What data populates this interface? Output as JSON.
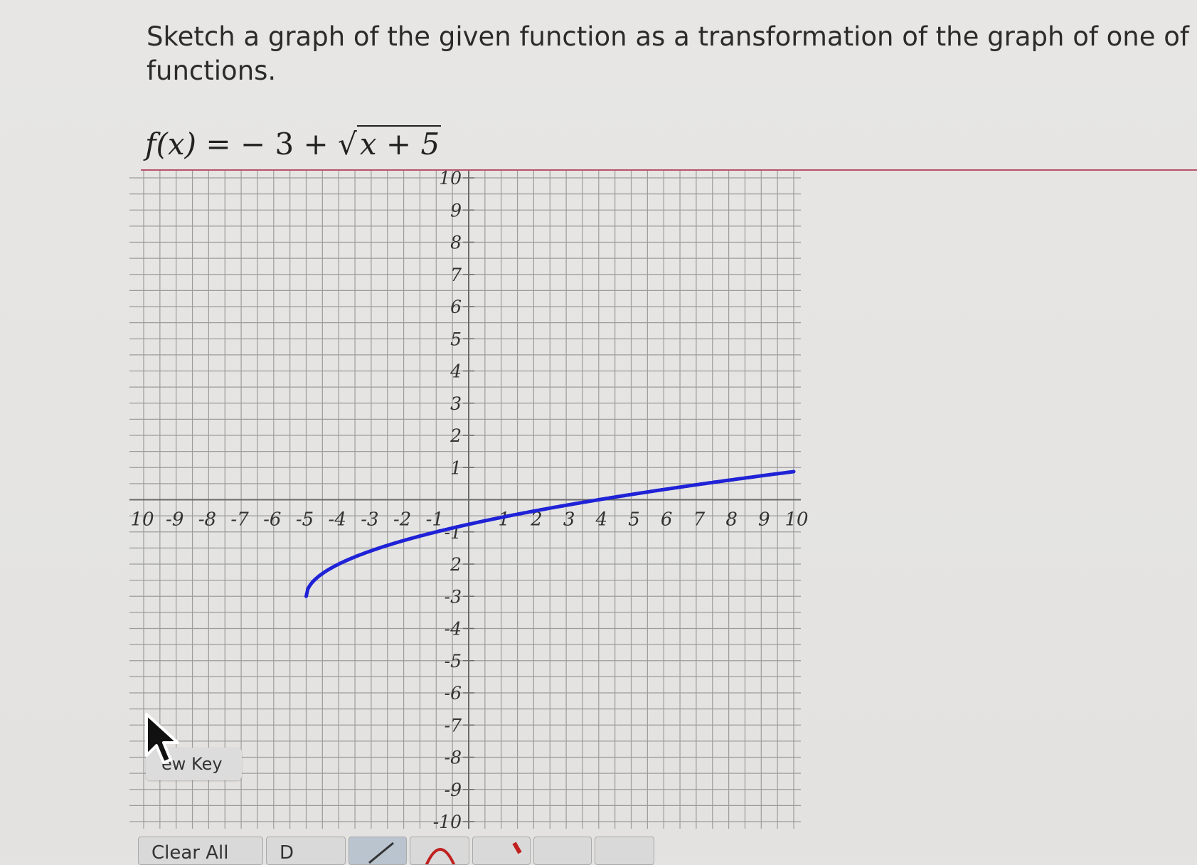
{
  "question": {
    "prompt_line1": "Sketch a graph of the given function as a transformation of the graph of one of the toolk",
    "prompt_line2": "functions.",
    "formula_fx": "f(x)",
    "formula_equals": "=",
    "formula_rest": "− 3 +",
    "formula_radicand": "x + 5"
  },
  "view_key_label": "ew Key",
  "toolbar": {
    "clear_all_label": "Clear All",
    "draw_label": "D"
  },
  "colors": {
    "curve": "#1f22d6",
    "grid": "#9c9c9c",
    "question_rule": "#b8536a"
  },
  "icons": [
    "cursor-arrow-icon",
    "line-tool-icon",
    "parabola-tool-icon",
    "pencil-tool-icon"
  ],
  "chart_data": {
    "type": "line",
    "title": "",
    "xlabel": "",
    "ylabel": "",
    "xlim": [
      -10,
      10
    ],
    "ylim": [
      -10,
      10
    ],
    "grid": true,
    "x_ticks": [
      "10",
      "-9",
      "-8",
      "-7",
      "-6",
      "-5",
      "-4",
      "-3",
      "-2",
      "-1",
      "1",
      "2",
      "3",
      "4",
      "5",
      "6",
      "7",
      "8",
      "9",
      "10"
    ],
    "x_tick_values": [
      -10,
      -9,
      -8,
      -7,
      -6,
      -5,
      -4,
      -3,
      -2,
      -1,
      1,
      2,
      3,
      4,
      5,
      6,
      7,
      8,
      9,
      10
    ],
    "y_ticks": [
      "10",
      "9",
      "8",
      "7",
      "6",
      "5",
      "4",
      "3",
      "2",
      "1",
      "-1",
      "2",
      "-3",
      "-4",
      "-5",
      "-6",
      "-7",
      "-8",
      "-9",
      "-10"
    ],
    "y_tick_values": [
      10,
      9,
      8,
      7,
      6,
      5,
      4,
      3,
      2,
      1,
      -1,
      -2,
      -3,
      -4,
      -5,
      -6,
      -7,
      -8,
      -9,
      -10
    ],
    "series": [
      {
        "x": [
          -5,
          -4.8,
          -4.5,
          -4,
          -3,
          -2,
          -1,
          0,
          1,
          2,
          3,
          4,
          5,
          6,
          7,
          8,
          9,
          10
        ],
        "y": [
          -3,
          -2.55,
          -2.29,
          -2,
          -1.59,
          -1.27,
          -0.55,
          -0.76,
          -0.55,
          -0.35,
          -0.17,
          0,
          0.16,
          0.32,
          0.46,
          0.61,
          0.74,
          0.87
        ],
        "values_note_free": true
      }
    ]
  }
}
